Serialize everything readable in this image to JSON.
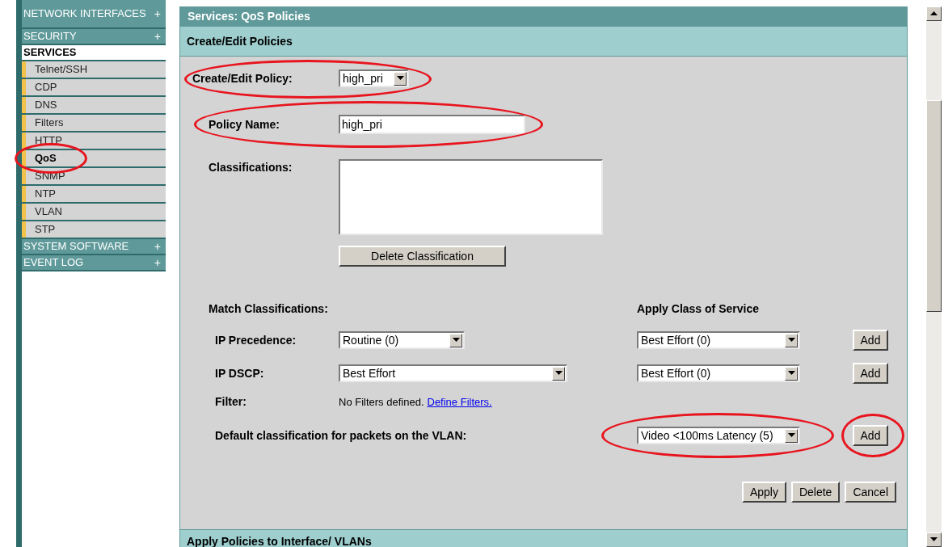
{
  "sidebar": {
    "items": [
      {
        "label": "NETWORK INTERFACES",
        "toggle": "+",
        "selected": false
      },
      {
        "label": "SECURITY",
        "toggle": "+",
        "selected": false
      },
      {
        "label": "SERVICES",
        "selected": true,
        "children": [
          {
            "label": "Telnet/SSH",
            "selected": false,
            "circled": false
          },
          {
            "label": "CDP",
            "selected": false,
            "circled": false
          },
          {
            "label": "DNS",
            "selected": false,
            "circled": false
          },
          {
            "label": "Filters",
            "selected": false,
            "circled": false
          },
          {
            "label": "HTTP",
            "selected": false,
            "circled": false
          },
          {
            "label": "QoS",
            "selected": true,
            "circled": true
          },
          {
            "label": "SNMP",
            "selected": false,
            "circled": false
          },
          {
            "label": "NTP",
            "selected": false,
            "circled": false
          },
          {
            "label": "VLAN",
            "selected": false,
            "circled": false
          },
          {
            "label": "STP",
            "selected": false,
            "circled": false
          }
        ]
      },
      {
        "label": "SYSTEM SOFTWARE",
        "toggle": "+",
        "selected": false
      },
      {
        "label": "EVENT LOG",
        "toggle": "+",
        "selected": false
      }
    ]
  },
  "panel": {
    "title": "Services: QoS Policies",
    "section": "Create/Edit Policies",
    "policy_select": {
      "label": "Create/Edit Policy:",
      "value": "high_pri",
      "circled": true
    },
    "policy_name": {
      "label": "Policy Name:",
      "value": "high_pri",
      "circled": true
    },
    "classifications": {
      "label": "Classifications:",
      "button": "Delete Classification"
    },
    "match_heading": "Match Classifications:",
    "apply_heading": "Apply Class of Service",
    "match_rows": [
      {
        "label": "IP Precedence:",
        "match_value": "Routine (0)",
        "wide": false,
        "cos": "Best Effort (0)",
        "button": "Add"
      },
      {
        "label": "IP DSCP:",
        "match_value": "Best Effort",
        "wide": true,
        "cos": "Best Effort (0)",
        "button": "Add"
      }
    ],
    "filter": {
      "label": "Filter:",
      "text": "No Filters defined.",
      "link": "Define Filters."
    },
    "default_row": {
      "label": "Default classification for packets on the VLAN:",
      "cos": "Video <100ms Latency (5)",
      "button": "Add",
      "circled": true
    },
    "buttons": [
      "Apply",
      "Delete",
      "Cancel"
    ],
    "next_section": "Apply Policies to Interface/ VLANs"
  }
}
